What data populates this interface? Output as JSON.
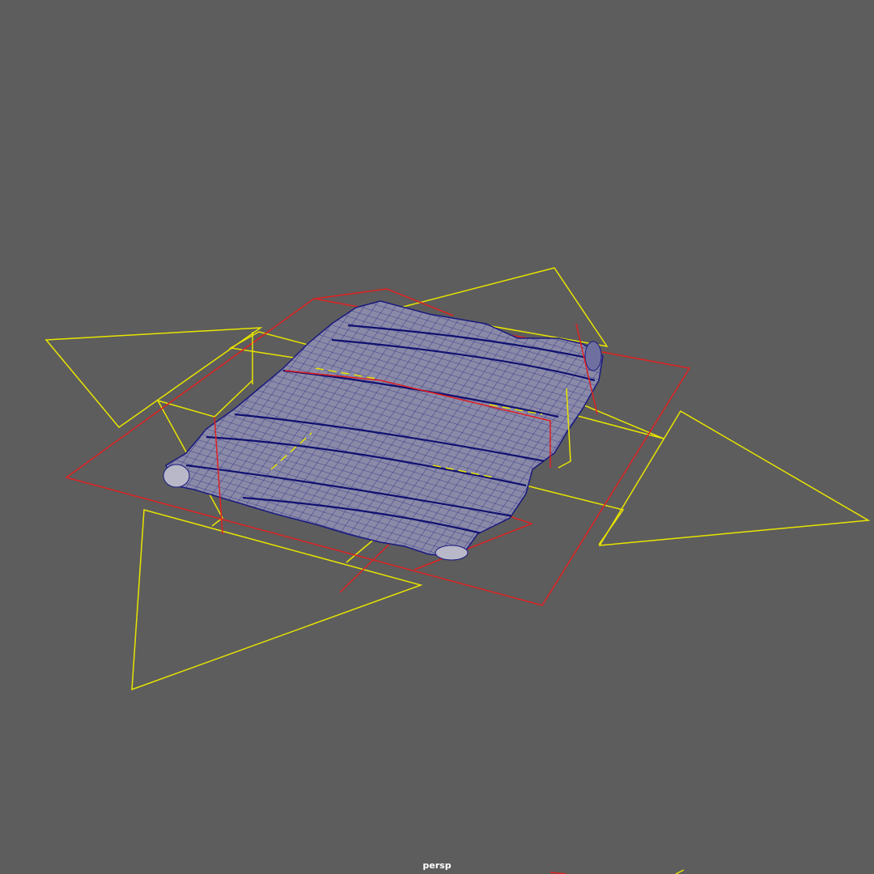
{
  "viewport": {
    "camera_label": "persp",
    "background_color": "#5d5d5d"
  },
  "colors": {
    "light_icons": "#e8e400",
    "selected_outlines": "#e02020",
    "mesh_fill": "#8a8aa8",
    "mesh_wire": "#1a1a80"
  },
  "scene": {
    "objects": [
      "cloth-mesh-wireframe",
      "area-light-gizmos",
      "selected-plane-outlines"
    ]
  }
}
